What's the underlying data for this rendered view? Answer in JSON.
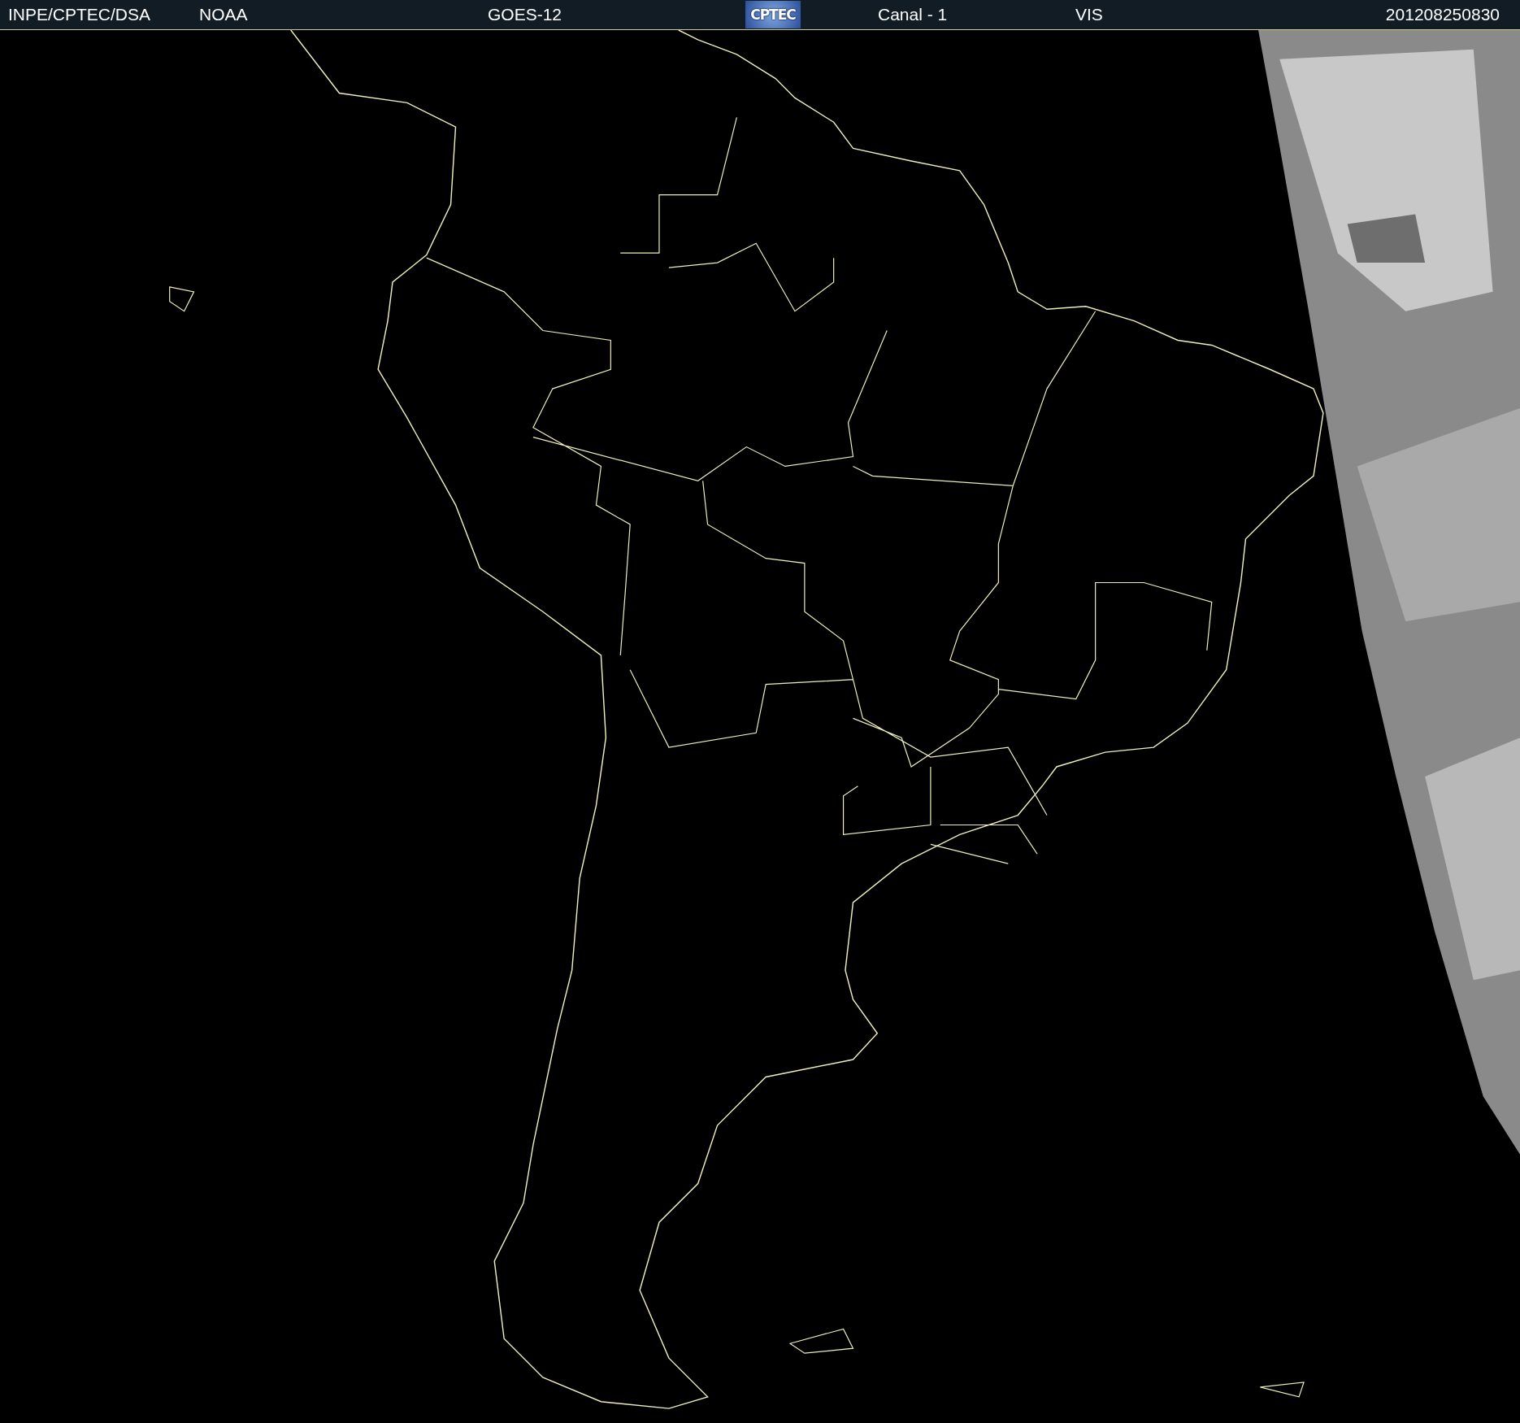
{
  "header": {
    "items": [
      {
        "kind": "text",
        "text": "INPE/CPTEC/DSA"
      },
      {
        "kind": "text",
        "text": "NOAA"
      },
      {
        "kind": "text",
        "text": "GOES-12"
      },
      {
        "kind": "logo",
        "text": "CPTEC"
      },
      {
        "kind": "text",
        "text": "Canal - 1"
      },
      {
        "kind": "text",
        "text": "VIS"
      },
      {
        "kind": "text",
        "text": "201208250830"
      }
    ]
  }
}
